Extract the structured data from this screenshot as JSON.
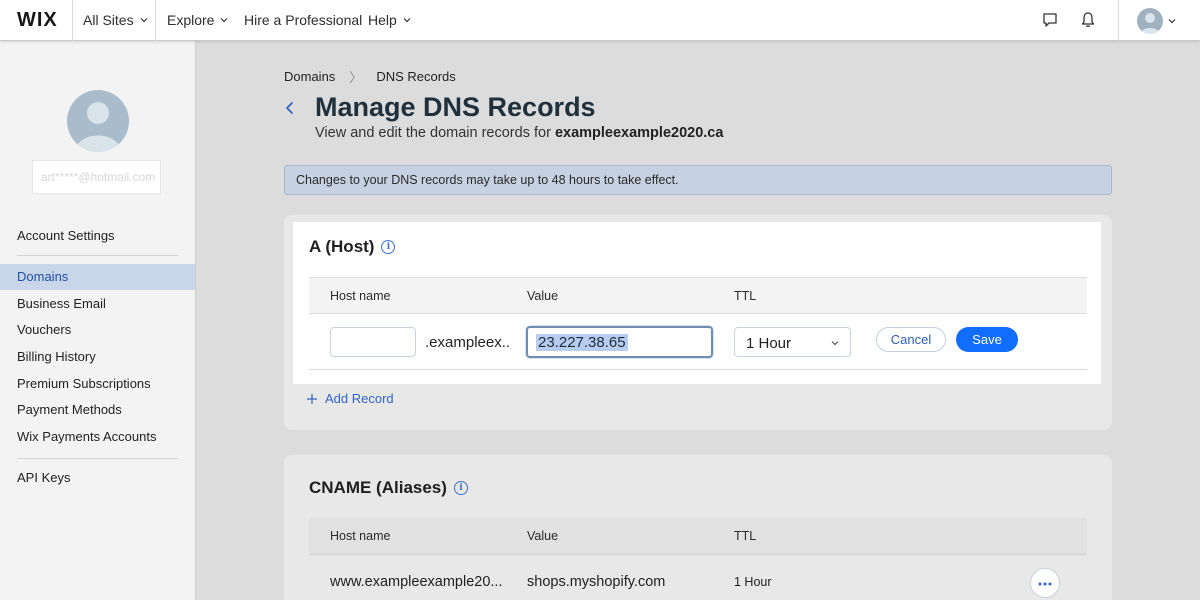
{
  "topbar": {
    "logo": "WIX",
    "all_sites": "All Sites",
    "explore": "Explore",
    "hire": "Hire a Professional",
    "help": "Help"
  },
  "sidebar": {
    "email": "art*****@hotmail.com",
    "items": [
      {
        "label": "Account Settings"
      },
      {
        "label": "Domains"
      },
      {
        "label": "Business Email"
      },
      {
        "label": "Vouchers"
      },
      {
        "label": "Billing History"
      },
      {
        "label": "Premium Subscriptions"
      },
      {
        "label": "Payment Methods"
      },
      {
        "label": "Wix Payments Accounts"
      },
      {
        "label": "API Keys"
      }
    ]
  },
  "breadcrumb": {
    "parent": "Domains",
    "separator": "〉",
    "current": "DNS Records"
  },
  "page": {
    "title": "Manage DNS Records",
    "subtitle": "View and edit the domain records for",
    "domain": "exampleexample2020.ca",
    "notice": "Changes to your DNS records may take up to 48 hours to take effect."
  },
  "a_section": {
    "title": "A (Host)",
    "col_host": "Host name",
    "col_value": "Value",
    "col_ttl": "TTL",
    "host_value": "",
    "host_suffix": ".exampleex...",
    "value": "23.227.38.65",
    "ttl": "1 Hour",
    "cancel": "Cancel",
    "save": "Save",
    "add_record": "Add Record"
  },
  "cname_section": {
    "title": "CNAME (Aliases)",
    "col_host": "Host name",
    "col_value": "Value",
    "col_ttl": "TTL",
    "rows": [
      {
        "host": "www.exampleexample20...",
        "value": "shops.myshopify.com",
        "ttl": "1 Hour"
      }
    ]
  },
  "colors": {
    "accent": "#116dff",
    "active_nav_bg": "#c9d6ea",
    "notice_bg": "#c6d2e2"
  }
}
